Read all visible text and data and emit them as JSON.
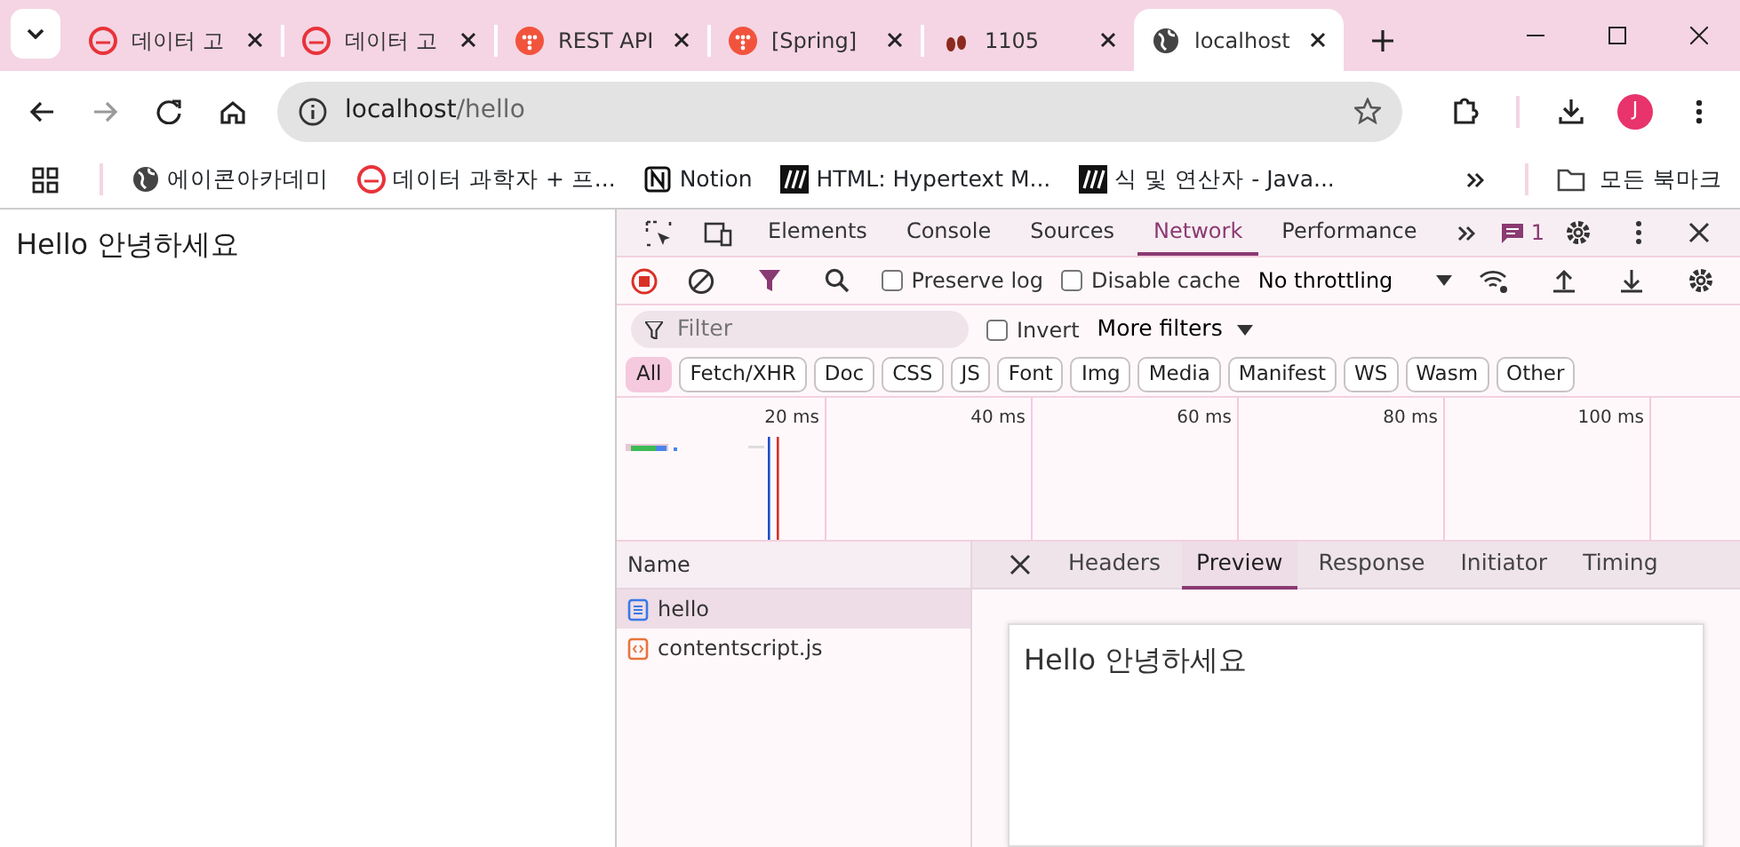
{
  "browser_tabs": [
    {
      "title": "데이터 고",
      "kind": "cafe",
      "selected": false
    },
    {
      "title": "데이터 고",
      "kind": "cafe",
      "selected": false
    },
    {
      "title": "REST API",
      "kind": "tistory",
      "selected": false
    },
    {
      "title": "[Spring]",
      "kind": "tistory",
      "selected": false
    },
    {
      "title": "1105",
      "kind": "feet",
      "selected": false
    },
    {
      "title": "localhost",
      "kind": "globe",
      "selected": true
    }
  ],
  "address": {
    "host": "localhost",
    "path": "/hello"
  },
  "profile": "J",
  "bookmarks": [
    {
      "label": "에이콘아카데미",
      "kind": "globe"
    },
    {
      "label": "데이터 과학자 + 프...",
      "kind": "cafe"
    },
    {
      "label": "Notion",
      "kind": "notion"
    },
    {
      "label": "HTML: Hypertext M...",
      "kind": "mdn"
    },
    {
      "label": "식 및 연산자 - Java...",
      "kind": "mdn"
    }
  ],
  "all_bookmarks": "모든 북마크",
  "page_text": "Hello 안녕하세요",
  "devtools": {
    "panels": [
      {
        "label": "Elements",
        "selected": false
      },
      {
        "label": "Console",
        "selected": false
      },
      {
        "label": "Sources",
        "selected": false
      },
      {
        "label": "Network",
        "selected": true
      },
      {
        "label": "Performance",
        "selected": false
      }
    ],
    "issues_count": "1",
    "recording": true,
    "preserve_log": {
      "label": "Preserve log",
      "checked": false
    },
    "disable_cache": {
      "label": "Disable cache",
      "checked": false
    },
    "throttling": "No throttling",
    "filter": {
      "placeholder": "Filter"
    },
    "invert": {
      "label": "Invert",
      "checked": false
    },
    "more_filters": "More filters",
    "type_filters": [
      {
        "label": "All",
        "selected": true
      },
      {
        "label": "Fetch/XHR",
        "selected": false
      },
      {
        "label": "Doc",
        "selected": false
      },
      {
        "label": "CSS",
        "selected": false
      },
      {
        "label": "JS",
        "selected": false
      },
      {
        "label": "Font",
        "selected": false
      },
      {
        "label": "Img",
        "selected": false
      },
      {
        "label": "Media",
        "selected": false
      },
      {
        "label": "Manifest",
        "selected": false
      },
      {
        "label": "WS",
        "selected": false
      },
      {
        "label": "Wasm",
        "selected": false
      },
      {
        "label": "Other",
        "selected": false
      }
    ],
    "timeline_ticks": [
      "20 ms",
      "40 ms",
      "60 ms",
      "80 ms",
      "100 ms"
    ],
    "name_header": "Name",
    "requests": [
      {
        "name": "hello",
        "kind": "document",
        "selected": true
      },
      {
        "name": "contentscript.js",
        "kind": "script",
        "selected": false
      }
    ],
    "detail_tabs": [
      {
        "label": "Headers",
        "selected": false
      },
      {
        "label": "Preview",
        "selected": true
      },
      {
        "label": "Response",
        "selected": false
      },
      {
        "label": "Initiator",
        "selected": false
      },
      {
        "label": "Timing",
        "selected": false
      }
    ],
    "preview_text": "Hello 안녕하세요"
  }
}
